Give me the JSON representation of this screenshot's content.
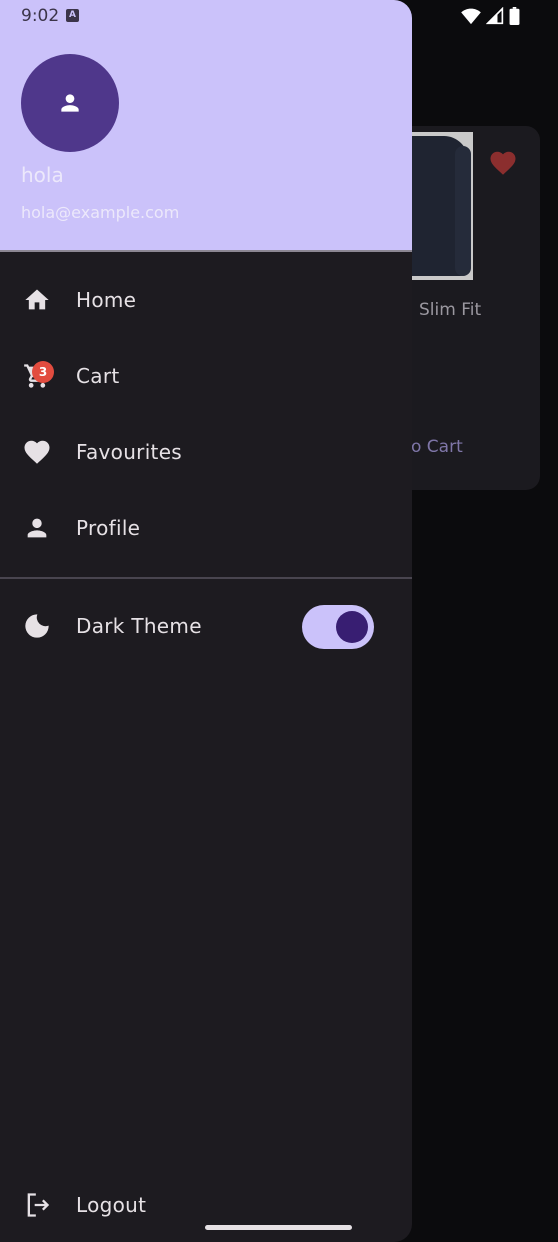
{
  "status_bar": {
    "time": "9:02",
    "notification_icon_letter": "A",
    "icons": [
      "wifi-icon",
      "signal-icon",
      "battery-icon"
    ]
  },
  "background": {
    "product_title": "Slim Fit",
    "action_label": "o Cart",
    "favourite_icon": "heart-icon",
    "favourite_color": "#8b2e2e"
  },
  "drawer": {
    "header": {
      "name": "hola",
      "email": "hola@example.com",
      "avatar_icon": "person-icon",
      "background_color": "#cbc2fa",
      "avatar_color": "#4f378b"
    },
    "items": [
      {
        "label": "Home",
        "icon": "home-icon"
      },
      {
        "label": "Cart",
        "icon": "cart-icon",
        "badge": "3"
      },
      {
        "label": "Favourites",
        "icon": "heart-icon"
      },
      {
        "label": "Profile",
        "icon": "person-icon"
      }
    ],
    "theme_toggle": {
      "label": "Dark Theme",
      "icon": "moon-icon",
      "on": true
    },
    "logout": {
      "label": "Logout",
      "icon": "logout-icon"
    },
    "background_color": "#1d1b20",
    "accent_color": "#cbc2fa"
  }
}
